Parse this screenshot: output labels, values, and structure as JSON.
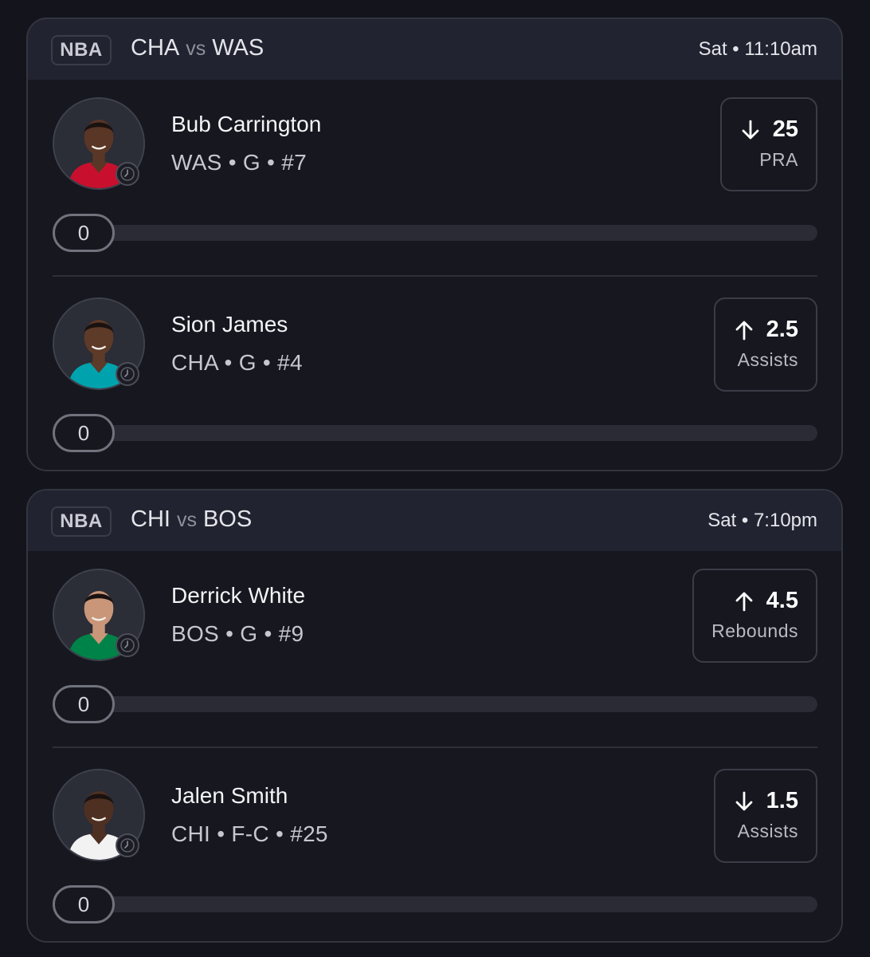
{
  "games": [
    {
      "league": "NBA",
      "home": "CHA",
      "vs": "vs",
      "away": "WAS",
      "time": "Sat • 11:10am",
      "players": [
        {
          "name": "Bub Carrington",
          "meta": "WAS • G • #7",
          "direction": "down",
          "line": "25",
          "stat": "PRA",
          "progress": "0",
          "jersey_color": "#c8102e",
          "skin": "#5a3626"
        },
        {
          "name": "Sion James",
          "meta": "CHA • G • #4",
          "direction": "up",
          "line": "2.5",
          "stat": "Assists",
          "progress": "0",
          "jersey_color": "#00a3ad",
          "skin": "#5e3a28"
        }
      ]
    },
    {
      "league": "NBA",
      "home": "CHI",
      "vs": "vs",
      "away": "BOS",
      "time": "Sat • 7:10pm",
      "players": [
        {
          "name": "Derrick White",
          "meta": "BOS • G • #9",
          "direction": "up",
          "line": "4.5",
          "stat": "Rebounds",
          "progress": "0",
          "jersey_color": "#008348",
          "skin": "#c99679"
        },
        {
          "name": "Jalen Smith",
          "meta": "CHI • F-C • #25",
          "direction": "down",
          "line": "1.5",
          "stat": "Assists",
          "progress": "0",
          "jersey_color": "#f2f2f2",
          "skin": "#4e3022"
        }
      ]
    }
  ]
}
